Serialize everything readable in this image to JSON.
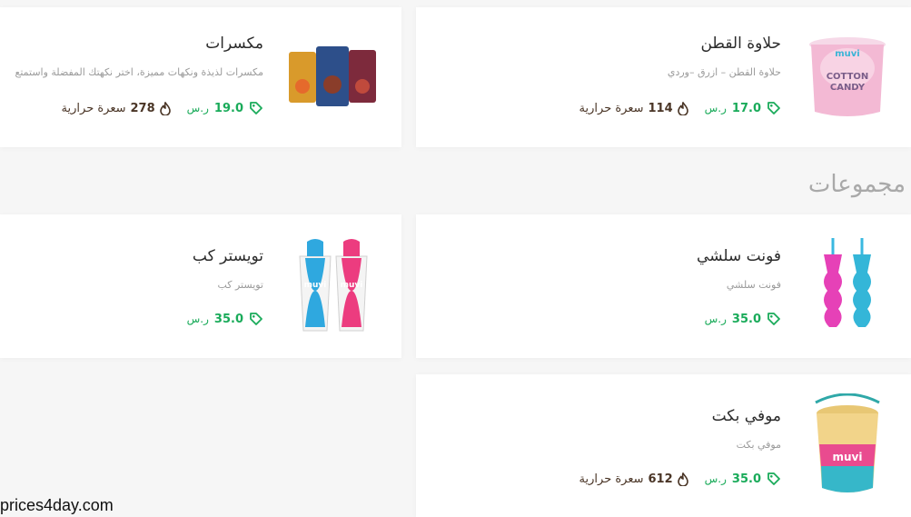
{
  "section_title": "مجموعات",
  "watermark": "prices4day.com",
  "products": {
    "cotton_candy": {
      "title": "حلاوة القطن",
      "desc": "حلاوة القطن – ازرق –وردي",
      "price": "17.0",
      "currency": "ر.س",
      "calories": "114",
      "cal_label": "سعرة حرارية",
      "image_text": [
        "COTTON",
        "CANDY"
      ]
    },
    "nuts": {
      "title": "مكسرات",
      "desc": "مكسرات لذيذة ونكهات مميزة، اختر نكهتك المفضلة واستمتع",
      "price": "19.0",
      "currency": "ر.س",
      "calories": "278",
      "cal_label": "سعرة حرارية"
    },
    "font_slushie": {
      "title": "فونت سلشي",
      "desc": "فونت سلشي",
      "price": "35.0",
      "currency": "ر.س"
    },
    "twister_cup": {
      "title": "تويستر كب",
      "desc": "تويستر كب",
      "price": "35.0",
      "currency": "ر.س",
      "image_text": "muvi"
    },
    "muvi_bucket": {
      "title": "موفي بكت",
      "desc": "موفي بكت",
      "price": "35.0",
      "currency": "ر.س",
      "calories": "612",
      "cal_label": "سعرة حرارية",
      "image_text": "muvi"
    }
  },
  "colors": {
    "price": "#1aab5a",
    "calories": "#4a3526",
    "title": "#2b2b2b",
    "section": "#a9a9a9"
  },
  "icons": {
    "price": "price-tag-icon",
    "calories": "flame-icon"
  }
}
